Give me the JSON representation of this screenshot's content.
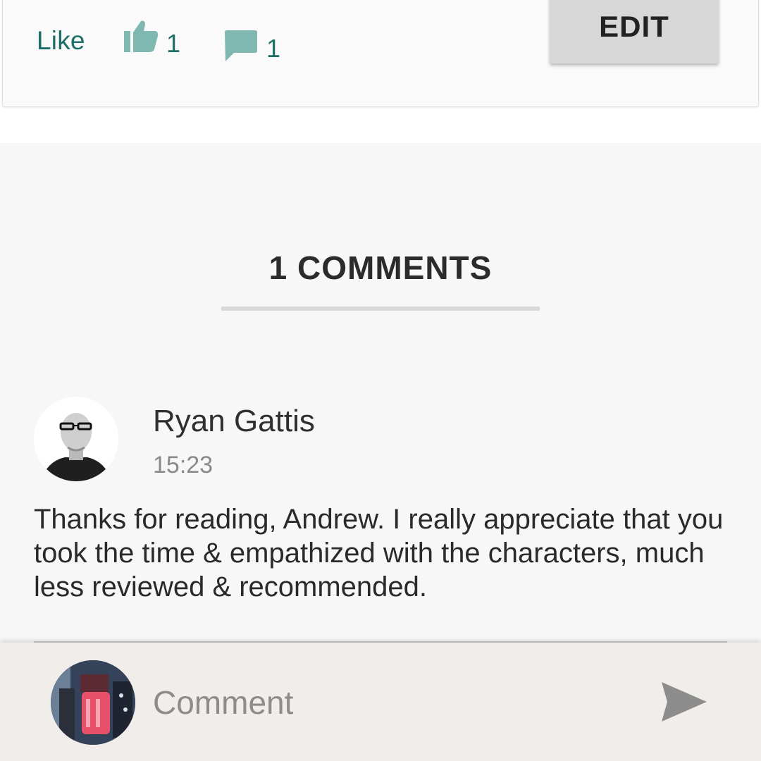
{
  "post_actions": {
    "like_label": "Like",
    "like_count": "1",
    "comment_count": "1",
    "edit_label": "EDIT"
  },
  "comments": {
    "heading": "1 COMMENTS",
    "items": [
      {
        "author": "Ryan Gattis",
        "time": "15:23",
        "text": "Thanks for reading, Andrew. I really appreciate that you took the time & empathized with the characters, much less reviewed & recommended."
      }
    ]
  },
  "compose": {
    "placeholder": "Comment"
  },
  "icons": {
    "like": "thumbs-up-icon",
    "comment": "speech-bubble-icon",
    "send": "send-icon"
  },
  "colors": {
    "accent": "#1d6e66",
    "icon_tint": "#7fb8b1",
    "compose_bg": "#f1edea",
    "section_bg": "#f7f7f7",
    "edit_bg": "#d7d7d7"
  }
}
